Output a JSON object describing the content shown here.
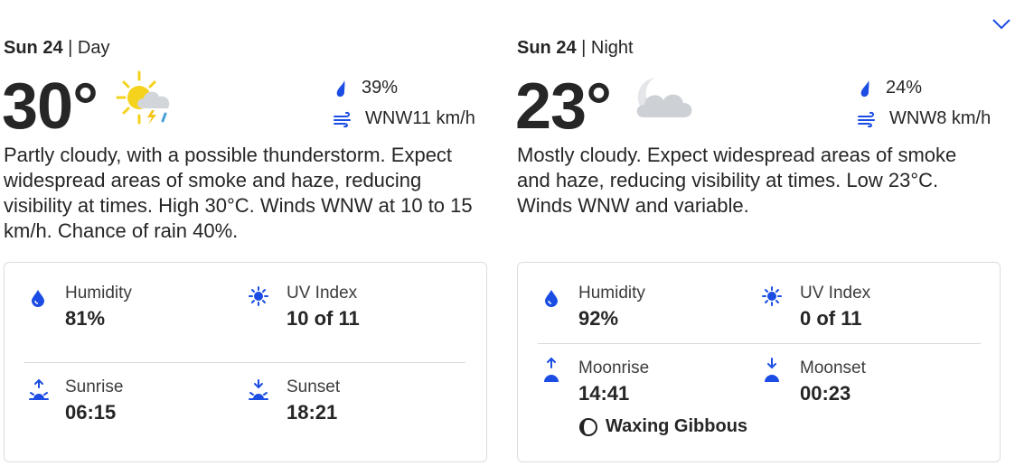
{
  "day": {
    "date": "Sun 24",
    "separator": "|",
    "period": "Day",
    "temp": "30°",
    "weather_icon": "partly-cloudy-thunderstorm-icon",
    "rain_chance": "39%",
    "wind": "WNW11 km/h",
    "description": "Partly cloudy, with a possible thunderstorm. Expect widespread areas of smoke and haze, reducing visibility at times. High 30°C. Winds WNW at 10 to 15 km/h. Chance of rain 40%.",
    "humidity_label": "Humidity",
    "humidity_value": "81%",
    "uv_label": "UV Index",
    "uv_value": "10 of 11",
    "sunrise_label": "Sunrise",
    "sunrise_value": "06:15",
    "sunset_label": "Sunset",
    "sunset_value": "18:21"
  },
  "night": {
    "date": "Sun 24",
    "separator": "|",
    "period": "Night",
    "temp": "23°",
    "weather_icon": "mostly-cloudy-night-icon",
    "rain_chance": "24%",
    "wind": "WNW8 km/h",
    "description": "Mostly cloudy. Expect widespread areas of smoke and haze, reducing visibility at times. Low 23°C. Winds WNW and variable.",
    "humidity_label": "Humidity",
    "humidity_value": "92%",
    "uv_label": "UV Index",
    "uv_value": "0 of 11",
    "moonrise_label": "Moonrise",
    "moonrise_value": "14:41",
    "moonset_label": "Moonset",
    "moonset_value": "00:23",
    "moon_phase": "Waxing Gibbous"
  },
  "colors": {
    "accent": "#1b4de4",
    "sun": "#f5d21c",
    "text": "#262626"
  }
}
